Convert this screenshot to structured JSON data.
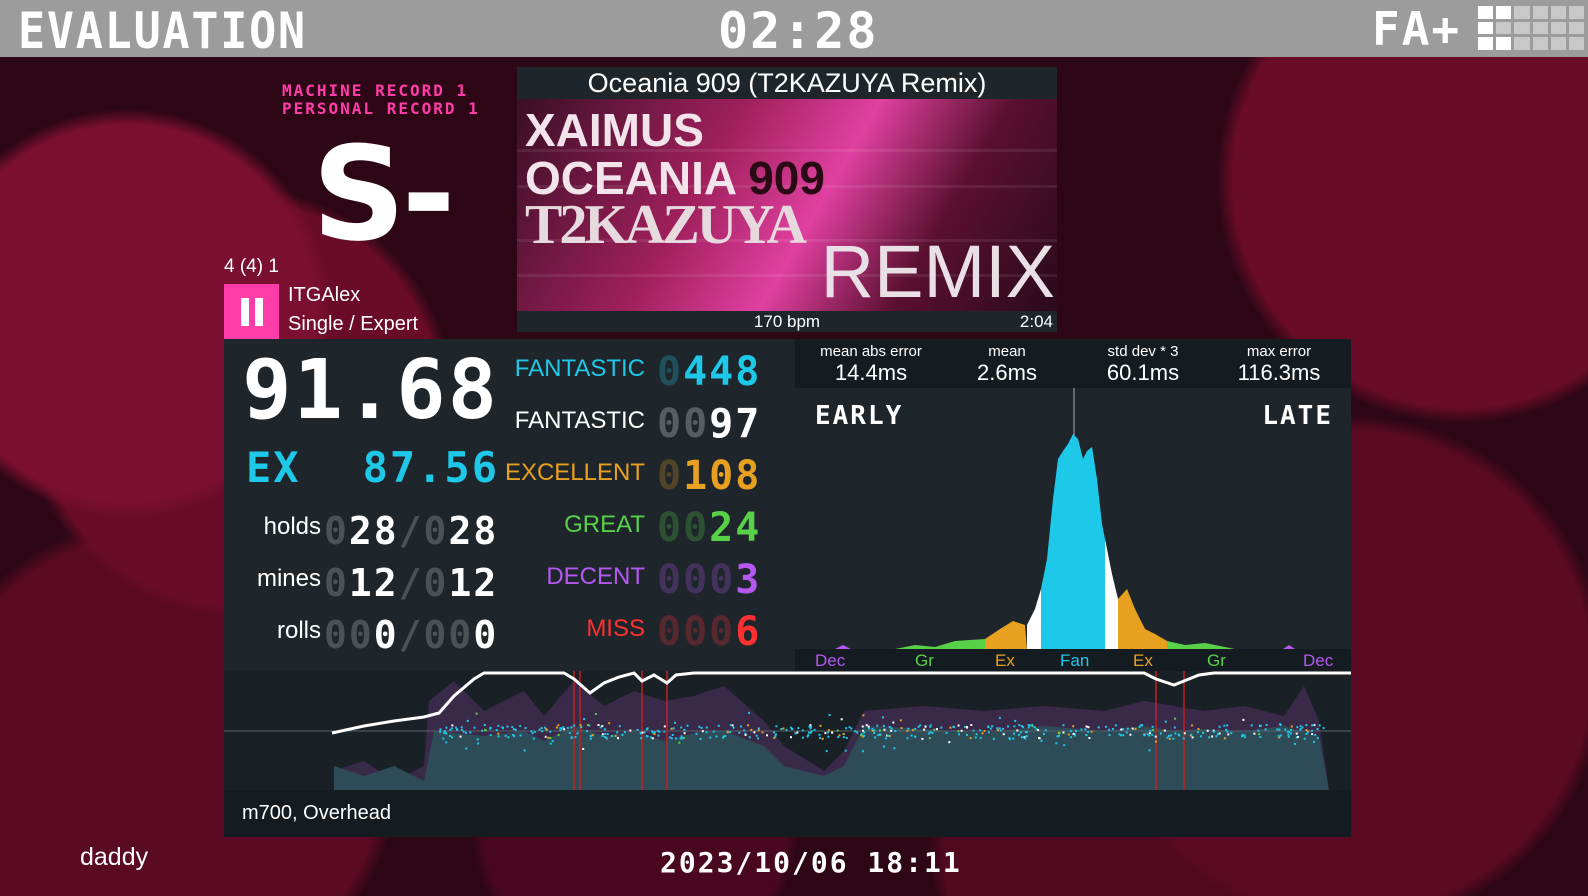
{
  "header": {
    "title": "EVALUATION",
    "timer": "02:28",
    "mode": "FA+"
  },
  "records": {
    "machine": "MACHINE RECORD 1",
    "personal": "PERSONAL RECORD 1"
  },
  "grade": "S-",
  "player": {
    "ratio": "4 (4) 1",
    "name": "ITGAlex",
    "chart": "Single / Expert"
  },
  "song": {
    "title": "Oceania 909 (T2KAZUYA Remix)",
    "banner_artist": "XAIMUS",
    "banner_song_word": "OCEANIA",
    "banner_song_num": "909",
    "banner_remixer": "T2KAZUYA",
    "banner_remix": "REMIX",
    "bpm": "170 bpm",
    "length": "2:04"
  },
  "score": {
    "percent": "91.68",
    "ex_label": "EX",
    "ex_percent": "87.56"
  },
  "radar": [
    {
      "label": "holds",
      "dim": "0",
      "value": "28",
      "sep": "/",
      "total_dim": "0",
      "total": "28"
    },
    {
      "label": "mines",
      "dim": "0",
      "value": "12",
      "sep": "/",
      "total_dim": "0",
      "total": "12"
    },
    {
      "label": "rolls",
      "dim": "00",
      "value": "0",
      "sep": "/",
      "total_dim": "00",
      "total": "0"
    }
  ],
  "judgments": [
    {
      "label": "FANTASTIC",
      "dim": "0",
      "count": "448",
      "color": "#1ec8e8"
    },
    {
      "label": "FANTASTIC",
      "dim": "00",
      "count": "97",
      "color": "#ffffff"
    },
    {
      "label": "EXCELLENT",
      "dim": "0",
      "count": "108",
      "color": "#e8a020"
    },
    {
      "label": "GREAT",
      "dim": "00",
      "count": "24",
      "color": "#58d048"
    },
    {
      "label": "DECENT",
      "dim": "000",
      "count": "3",
      "color": "#b458f0"
    },
    {
      "label": "MISS",
      "dim": "000",
      "count": "6",
      "color": "#ff3030"
    }
  ],
  "stats": [
    {
      "label": "mean abs error",
      "value": "14.4ms"
    },
    {
      "label": "mean",
      "value": "2.6ms"
    },
    {
      "label": "std dev * 3",
      "value": "60.1ms"
    },
    {
      "label": "max error",
      "value": "116.3ms"
    }
  ],
  "histogram": {
    "early_label": "EARLY",
    "late_label": "LATE",
    "axis": [
      {
        "label": "Dec",
        "color": "#b458f0"
      },
      {
        "label": "Gr",
        "color": "#58d048"
      },
      {
        "label": "Ex",
        "color": "#e8a020"
      },
      {
        "label": "Fan",
        "color": "#1ec8e8"
      },
      {
        "label": "Ex",
        "color": "#e8a020"
      },
      {
        "label": "Gr",
        "color": "#58d048"
      },
      {
        "label": "Dec",
        "color": "#b458f0"
      }
    ]
  },
  "footer": {
    "modifiers": "m700, Overhead",
    "profile": "daddy",
    "datetime": "2023/10/06 18:11"
  },
  "colors": {
    "accent_pink": "#ff3ca8",
    "fantastic_blue": "#1ec8e8",
    "panel": "#1e262c"
  }
}
